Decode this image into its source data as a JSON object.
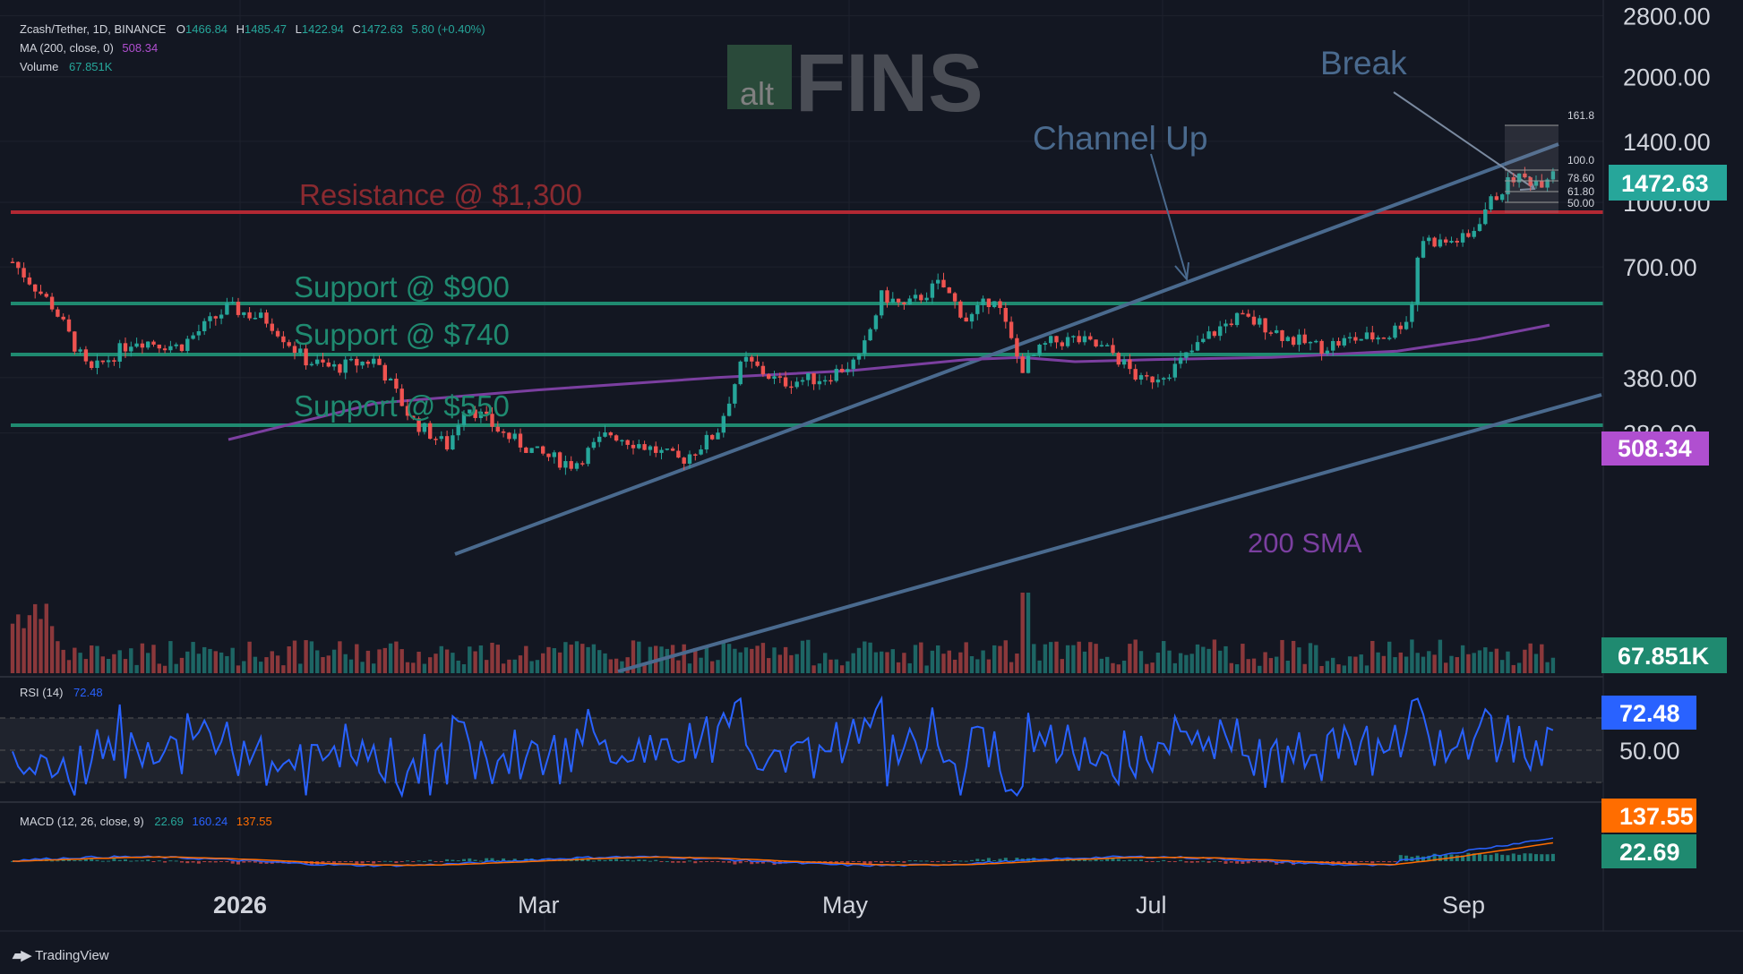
{
  "header": {
    "symbol": "Zcash/Tether, 1D, BINANCE",
    "ohlc": [
      {
        "k": "O",
        "v": "1466.84"
      },
      {
        "k": "H",
        "v": "1485.47"
      },
      {
        "k": "L",
        "v": "1422.94"
      },
      {
        "k": "C",
        "v": "1472.63"
      }
    ],
    "change": "5.80 (+0.40%)",
    "ma_label": "MA (200, close, 0)",
    "ma_value": "508.34",
    "volume_label": "Volume",
    "volume_value": "67.851K"
  },
  "watermark": {
    "prefix": "alt",
    "main": "FINS"
  },
  "annotations": {
    "resistance": "Resistance @ $1,300",
    "support_900": "Support @ $900",
    "support_740": "Support @ $740",
    "support_550": "Support @ $550",
    "channel": "Channel Up",
    "break": "Break",
    "sma": "200 SMA"
  },
  "fib_labels": [
    "161.8",
    "100.0",
    "78.60",
    "61.80",
    "50.00"
  ],
  "price_badges": {
    "last": "1472.63",
    "sma": "508.34",
    "volume": "67.851K"
  },
  "rsi": {
    "label": "RSI (14)",
    "value": "72.48",
    "axis_label": "50.00"
  },
  "macd": {
    "label": "MACD (12, 26, close, 9)",
    "macd": "22.69",
    "signal": "160.24",
    "hist": "137.55",
    "badge_top": "137.55",
    "badge_bottom": "22.69"
  },
  "footer": {
    "brand": "TradingView"
  },
  "chart_data": {
    "type": "candlestick",
    "y_scale": "log",
    "y_ticks": [
      2800,
      2000,
      1400,
      1000,
      700,
      380,
      280
    ],
    "y_tick_labels": [
      "2800.00",
      "2000.00",
      "1400.00",
      "1000.00",
      "700.00",
      "380.00",
      "280.00"
    ],
    "x_ticks": [
      "2026",
      "Mar",
      "May",
      "Jul",
      "Sep"
    ],
    "horizontal_levels": [
      {
        "name": "Resistance @ $1,300",
        "value": 1300
      },
      {
        "name": "Support @ $900",
        "value": 900
      },
      {
        "name": "Support @ $740",
        "value": 740
      },
      {
        "name": "Support @ $550",
        "value": 550
      }
    ],
    "last_price": 1472.63,
    "sma200_last": 508.34,
    "rsi_last": 72.48,
    "series_colors": {
      "up": "#26a69a",
      "down": "#ef5350",
      "sma": "#7b3fa0",
      "rsi": "#2962ff",
      "resistance": "#b22833",
      "support": "#1f8a70",
      "channel": "#4a6a8e"
    }
  }
}
